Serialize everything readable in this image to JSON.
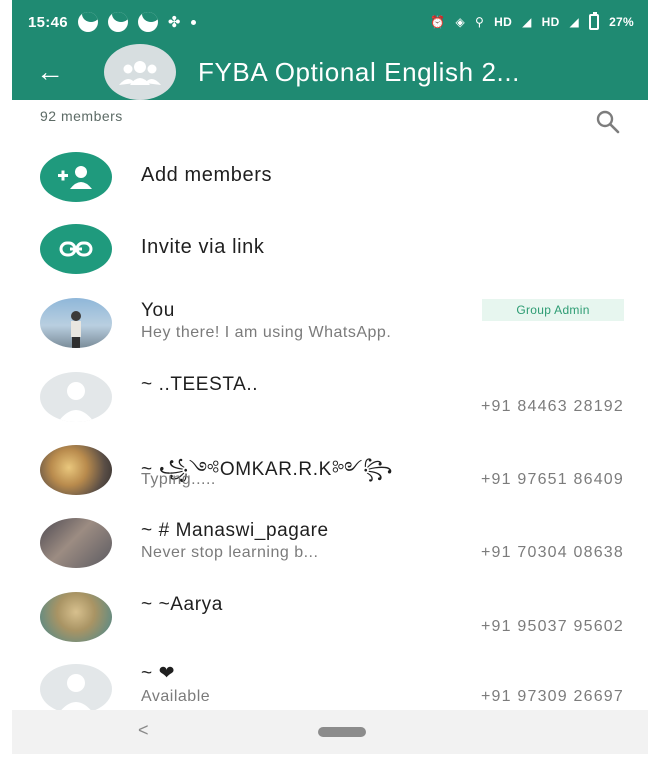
{
  "status_bar": {
    "time": "15:46",
    "right_text": "HD",
    "right_text2": "HD",
    "battery": "27%"
  },
  "toolbar": {
    "title": "FYBA Optional English 2..."
  },
  "members": {
    "count_label": "92 members"
  },
  "actions": [
    {
      "label": "Add members"
    },
    {
      "label": "Invite via link"
    }
  ],
  "participants": [
    {
      "name": "You",
      "subtitle": "Hey there! I am using WhatsApp.",
      "phone": "",
      "badge": "Group Admin"
    },
    {
      "name": "~ ..TEESTA..",
      "subtitle": "",
      "phone": "+91 84463 28192",
      "badge": ""
    },
    {
      "name": "~ ꧁༺OMKAR.R.K༻꧂",
      "subtitle": "Typing.....",
      "phone": "+91 97651 86409",
      "badge": ""
    },
    {
      "name": "~ # Manaswi_pagare",
      "subtitle": "Never stop learning b...",
      "phone": "+91 70304 08638",
      "badge": ""
    },
    {
      "name": "~ ~Aarya",
      "subtitle": "",
      "phone": "+91 95037 95602",
      "badge": ""
    },
    {
      "name": "~ ❤",
      "subtitle": "Available",
      "phone": "+91 97309 26697",
      "badge": ""
    }
  ],
  "colors": {
    "app_bar": "#1f8a72",
    "accent": "#1f9a7d"
  }
}
